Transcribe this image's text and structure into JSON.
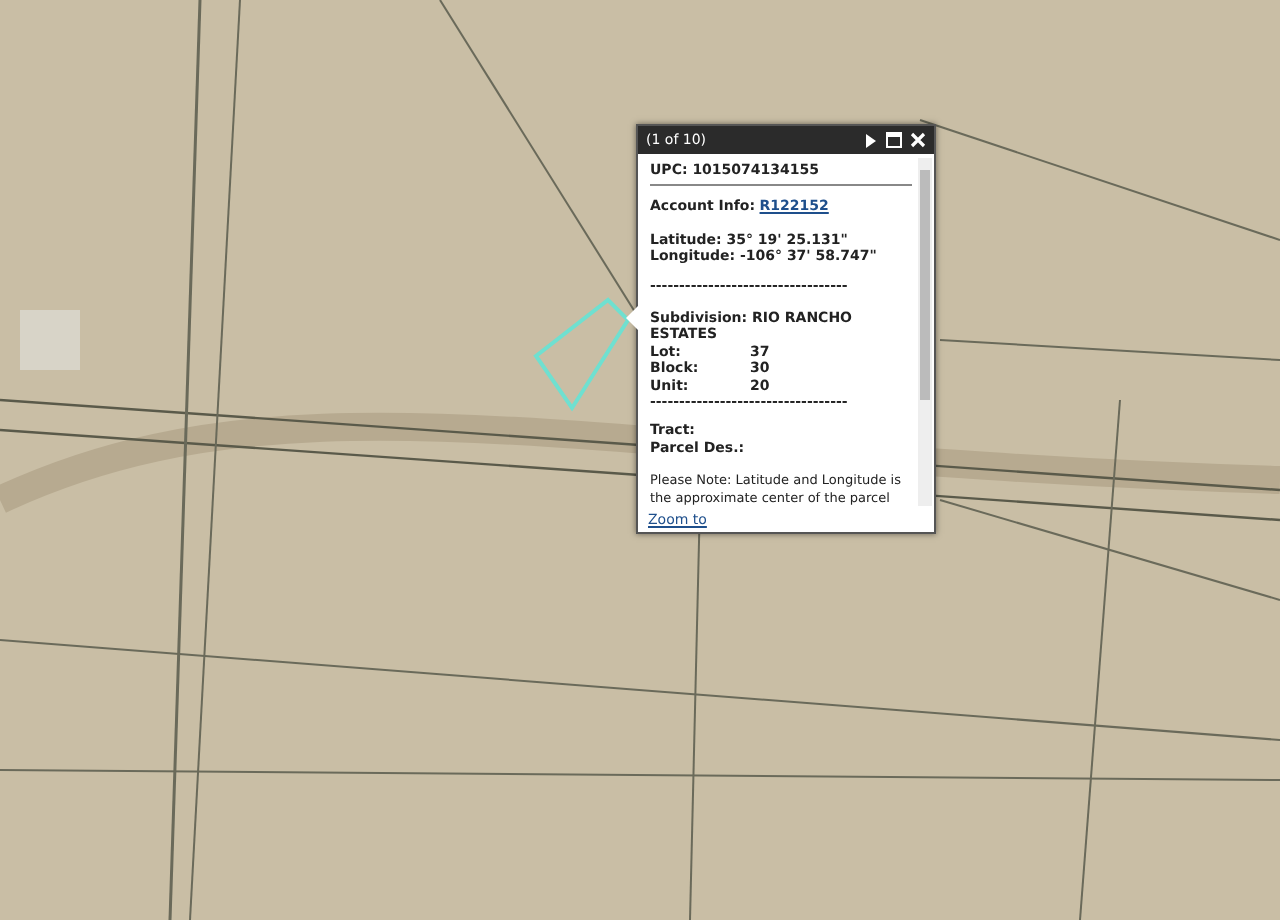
{
  "popup": {
    "title": "(1 of 10)",
    "upc": "UPC: 1015074134155",
    "account_label": "Account Info:",
    "account_link": "R122152",
    "latitude": "Latitude: 35° 19' 25.131\"",
    "longitude": "Longitude: -106° 37' 58.747\"",
    "separator": "----------------------------------",
    "subdivision": "Subdivision: RIO RANCHO ESTATES",
    "attributes": [
      {
        "label": "Lot:",
        "value": "37"
      },
      {
        "label": "Block:",
        "value": "30"
      },
      {
        "label": "Unit:",
        "value": "20"
      }
    ],
    "separator_2": "----------------------------------",
    "tract": "Tract:",
    "parcel_des": "Parcel Des.:",
    "note": "Please Note: Latitude and Longitude is the approximate center of the parcel",
    "zoom_link": "Zoom to"
  }
}
